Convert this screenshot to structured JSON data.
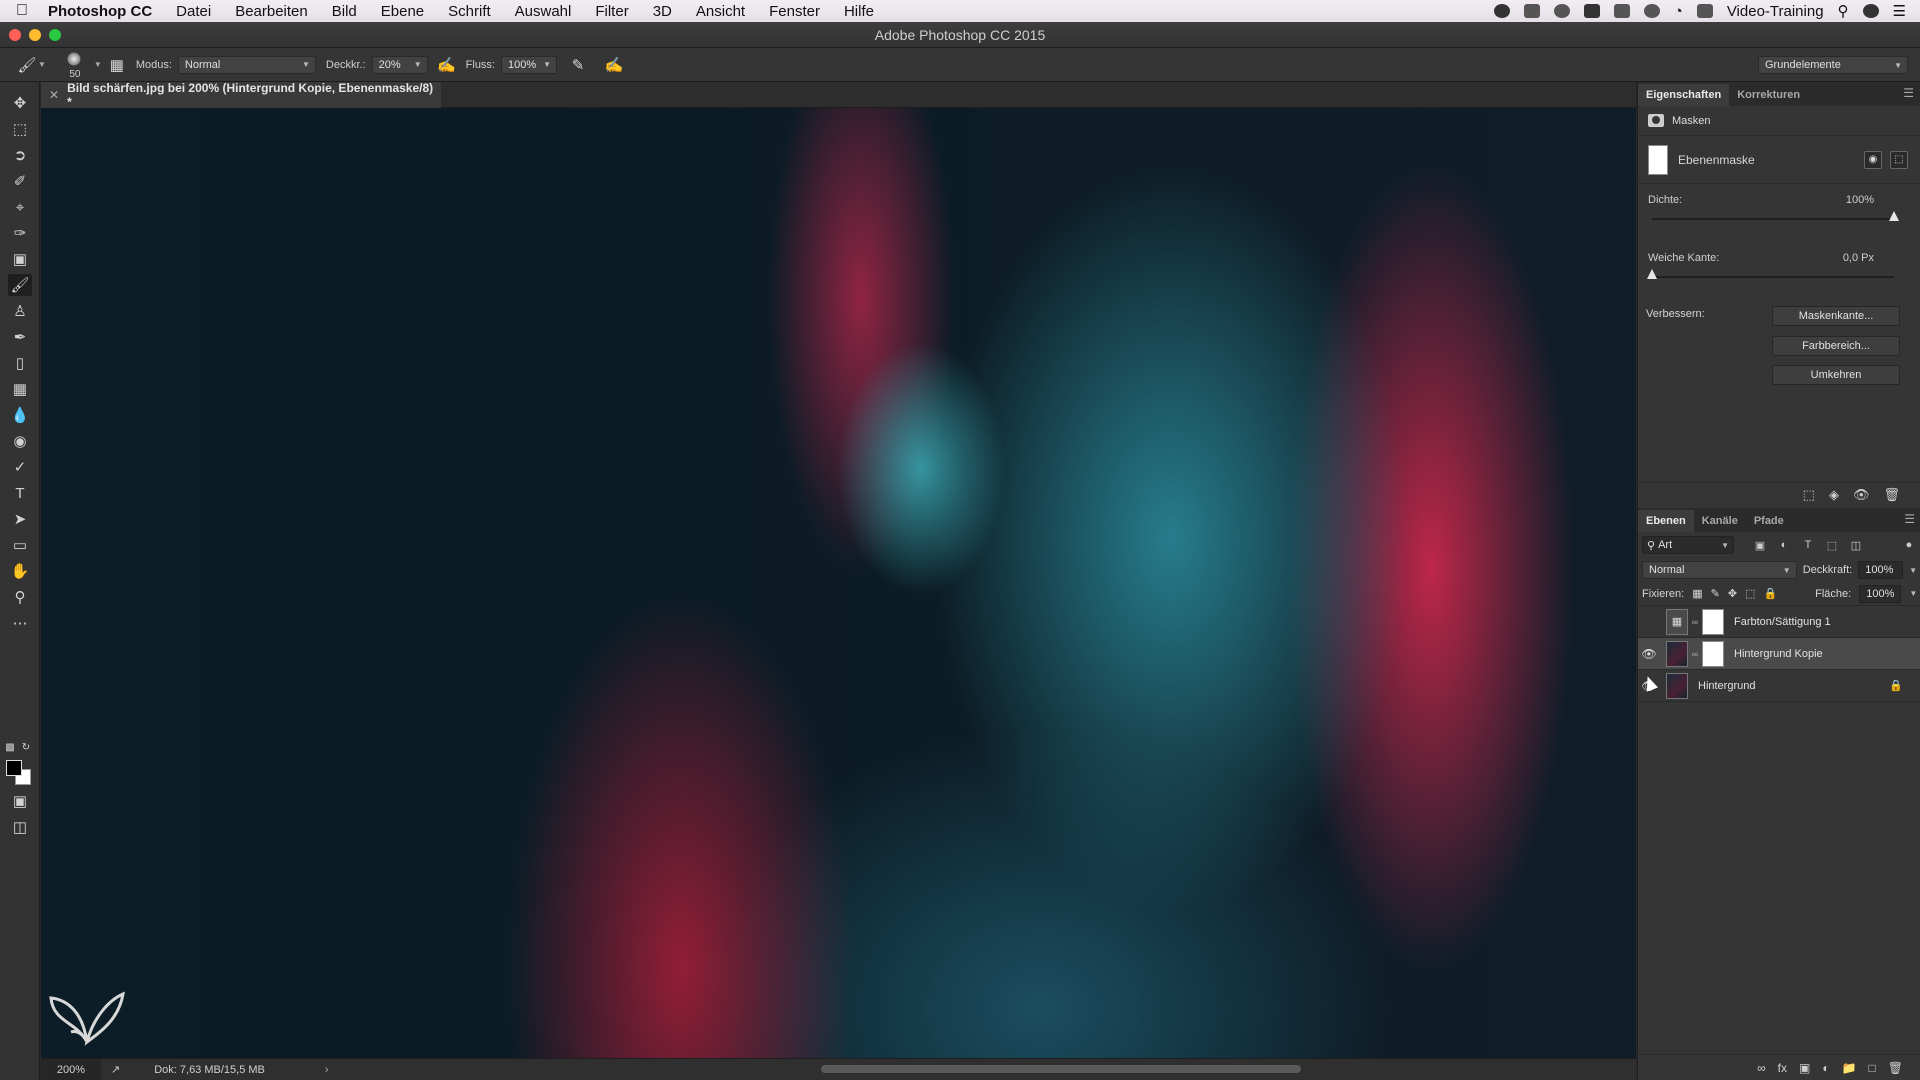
{
  "menubar": {
    "app": "Photoshop CC",
    "items": [
      "Datei",
      "Bearbeiten",
      "Bild",
      "Ebene",
      "Schrift",
      "Auswahl",
      "Filter",
      "3D",
      "Ansicht",
      "Fenster",
      "Hilfe"
    ],
    "user": "Video-Training"
  },
  "window": {
    "title": "Adobe Photoshop CC 2015"
  },
  "options": {
    "brush_size": "50",
    "mode_label": "Modus:",
    "mode_value": "Normal",
    "opacity_label": "Deckkr.:",
    "opacity_value": "20%",
    "flow_label": "Fluss:",
    "flow_value": "100%",
    "workspace": "Grundelemente"
  },
  "document": {
    "tab_title": "Bild schärfen.jpg bei 200% (Hintergrund Kopie, Ebenenmaske/8) *",
    "zoom": "200%",
    "doc_info": "Dok: 7,63 MB/15,5 MB"
  },
  "properties": {
    "tabs": [
      "Eigenschaften",
      "Korrekturen"
    ],
    "section": "Masken",
    "mask_type": "Ebenenmaske",
    "density_label": "Dichte:",
    "density_value": "100%",
    "density_fraction": 1.0,
    "feather_label": "Weiche Kante:",
    "feather_value": "0,0 Px",
    "feather_fraction": 0.0,
    "refine_label": "Verbessern:",
    "buttons": [
      "Maskenkante...",
      "Farbbereich...",
      "Umkehren"
    ]
  },
  "layers": {
    "tabs": [
      "Ebenen",
      "Kanäle",
      "Pfade"
    ],
    "filter_kind": "Art",
    "blend_mode": "Normal",
    "opacity_label": "Deckkraft:",
    "opacity_value": "100%",
    "lock_label": "Fixieren:",
    "fill_label": "Fläche:",
    "fill_value": "100%",
    "items": [
      {
        "name": "Farbton/Sättigung 1",
        "visible": false,
        "selected": false
      },
      {
        "name": "Hintergrund Kopie",
        "visible": true,
        "selected": true
      },
      {
        "name": "Hintergrund",
        "visible": true,
        "selected": false,
        "locked": true
      }
    ]
  },
  "colors": {
    "accent_pink": "#e8325f",
    "accent_teal": "#2f8f9e",
    "ui_dark": "#353535"
  }
}
